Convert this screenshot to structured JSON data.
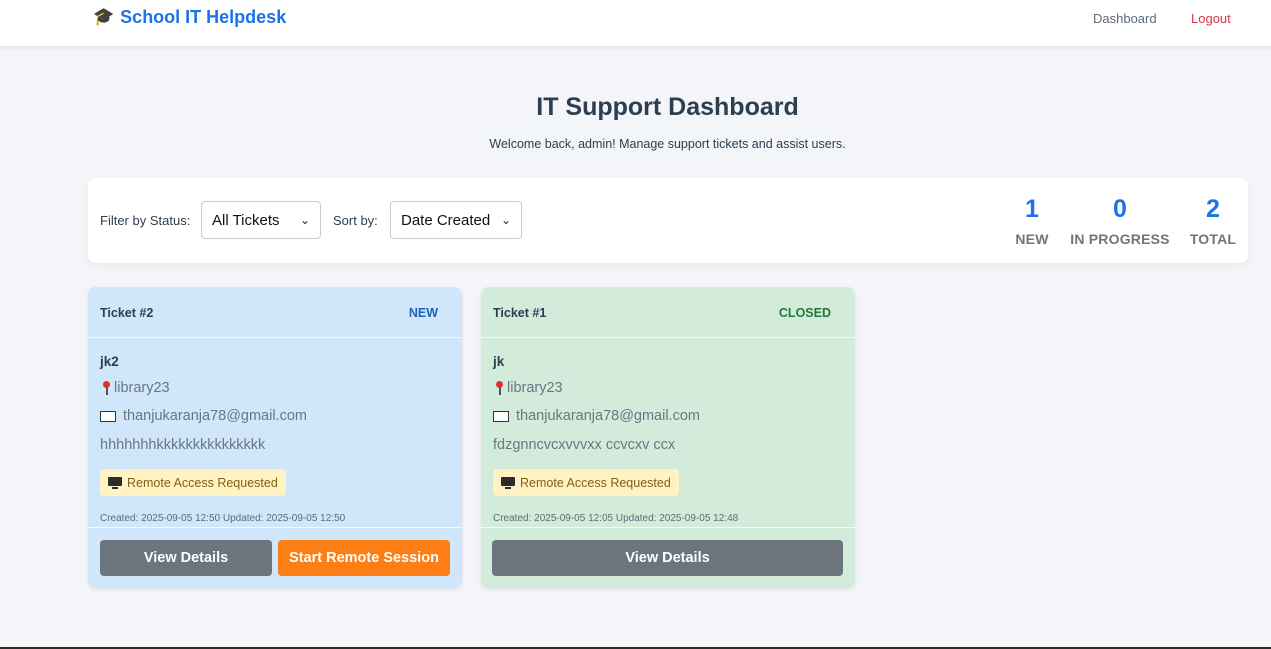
{
  "navbar": {
    "brand_icon": "graduation-cap-icon",
    "brand_glyph": "🎓",
    "brand_title": "School IT Helpdesk",
    "links": {
      "dashboard": "Dashboard",
      "logout": "Logout"
    }
  },
  "header": {
    "title": "IT Support Dashboard",
    "subtitle": "Welcome back, admin! Manage support tickets and assist users."
  },
  "controls": {
    "filter_label": "Filter by Status:",
    "filter_value": "All Tickets",
    "sort_label": "Sort by:",
    "sort_value": "Date Created",
    "chevron_glyph": "⌄"
  },
  "stats": [
    {
      "value": "1",
      "label": "NEW"
    },
    {
      "value": "0",
      "label": "IN PROGRESS"
    },
    {
      "value": "2",
      "label": "TOTAL"
    }
  ],
  "tickets": [
    {
      "id_label": "Ticket #2",
      "status": "NEW",
      "username": "jk2",
      "location": "library23",
      "email": "thanjukaranja78@gmail.com",
      "description": "hhhhhhhkkkkkkkkkkkkkkk",
      "badge": "Remote Access Requested",
      "timestamps": "Created: 2025-09-05 12:50 Updated: 2025-09-05 12:50",
      "view_label": "View Details",
      "remote_label": "Start Remote Session",
      "bg_color": "#cfe6fb"
    },
    {
      "id_label": "Ticket #1",
      "status": "CLOSED",
      "username": "jk",
      "location": "library23",
      "email": "thanjukaranja78@gmail.com",
      "description": "fdzgnncvcxvvvxx ccvcxv ccx",
      "badge": "Remote Access Requested",
      "timestamps": "Created: 2025-09-05 12:05 Updated: 2025-09-05 12:48",
      "view_label": "View Details",
      "bg_color": "#d3ebdb"
    }
  ],
  "colors": {
    "accent": "#1a73e8",
    "danger": "#dc3545",
    "orange": "#fd7e14",
    "gray_button": "#6c757d"
  }
}
